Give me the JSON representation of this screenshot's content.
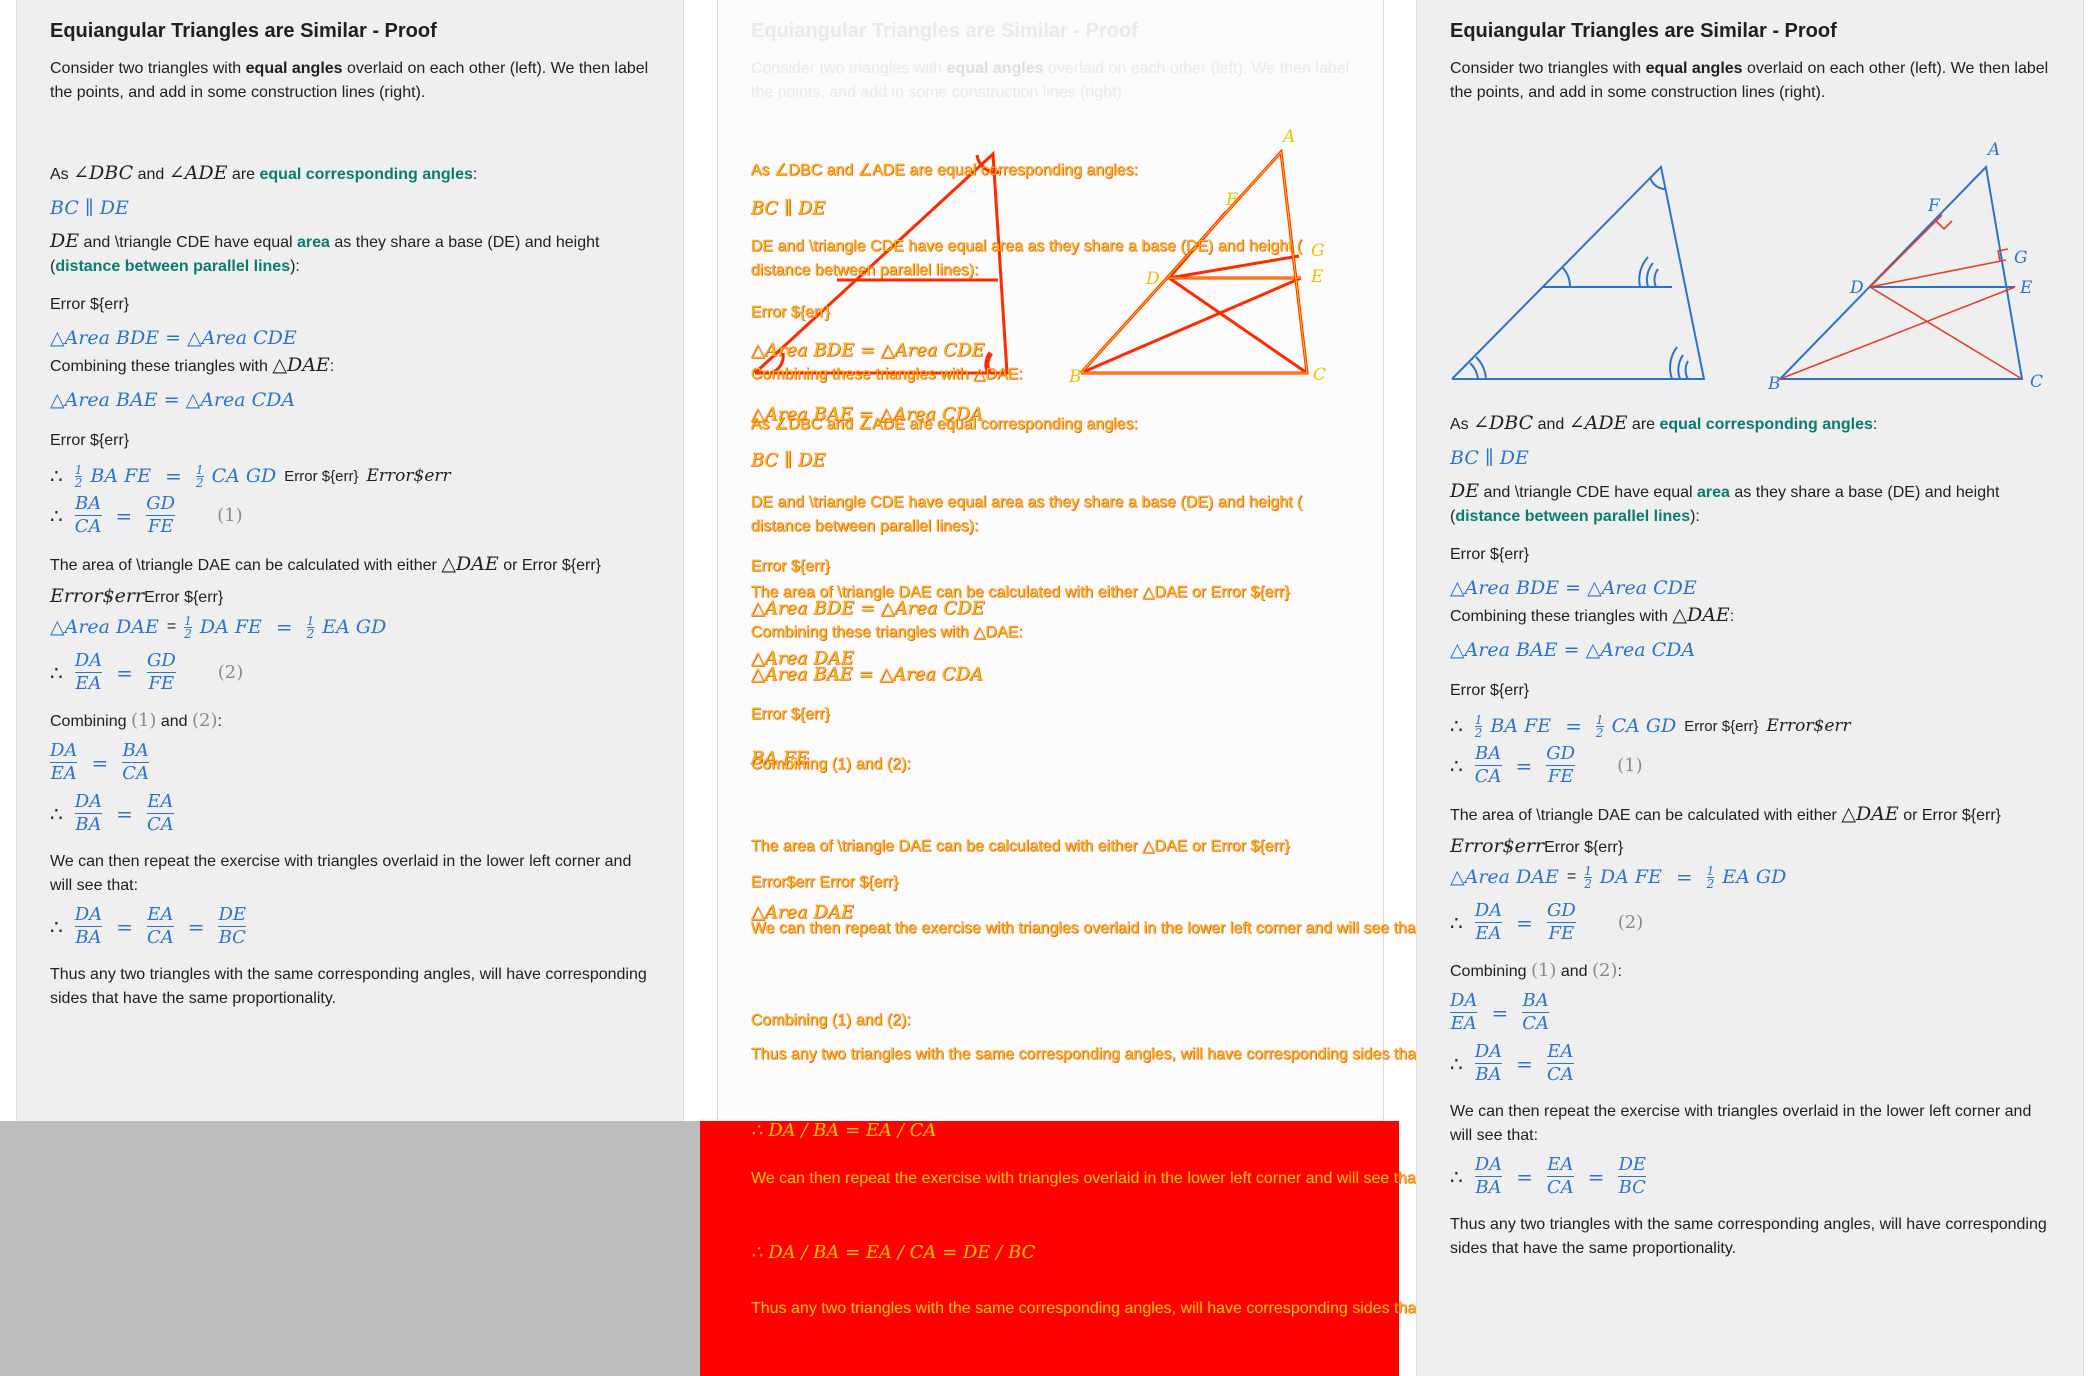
{
  "panels": {
    "title": "Equiangular Triangles are Similar - Proof",
    "intro_pre": "Consider two triangles with ",
    "intro_bold": "equal angles",
    "intro_post": " overlaid on each other (left). We then label the points, and add in some construction lines (right)."
  },
  "proof": {
    "s1_pre": "As ",
    "s1_m1": "∠DBC",
    "s1_mid": " and ",
    "s1_m2": "∠ADE",
    "s1_post": " are ",
    "s1_link": "equal corresponding angles",
    "s1_end": ":",
    "parallel": "BC ∥ DE",
    "s2_m": "DE",
    "s2_pre": " and \\triangle CDE have equal ",
    "s2_link1": "area",
    "s2_mid": " as they share a base (DE) and height (",
    "s2_link2": "distance between parallel lines",
    "s2_end": "):",
    "error": "Error ${err}",
    "area_eq1": "△Area BDE = △Area CDE",
    "combine_pre": "Combining these triangles with ",
    "combine_m": "△DAE",
    "combine_end": ":",
    "area_eq2": "△Area BAE = △Area CDA",
    "half_line_a": "BA FE",
    "half_line_b": "CA GD",
    "half_err_text": "Error ${err}",
    "half_err_math": "Error$err",
    "frac1_num": "BA",
    "frac1_den": "CA",
    "frac1_num2": "GD",
    "frac1_den2": "FE",
    "eq1_label": "(1)",
    "s3_pre": "The area of \\triangle DAE can be calculated with either ",
    "s3_m": "△DAE",
    "s3_post": " or Error ${err}",
    "err_math": "Error$err",
    "area_eq3_a": "△Area DAE",
    "area_eq3_b": "DA FE",
    "area_eq3_c": "EA GD",
    "frac2_num": "DA",
    "frac2_den": "EA",
    "frac2_num2": "GD",
    "frac2_den2": "FE",
    "eq2_label": "(2)",
    "combining_pre": "Combining ",
    "combining_1": "(1)",
    "combining_and": " and ",
    "combining_2": "(2)",
    "combining_end": ":",
    "f3_num": "DA",
    "f3_den": "EA",
    "f3_num2": "BA",
    "f3_den2": "CA",
    "f4_num": "DA",
    "f4_den": "BA",
    "f4_num2": "EA",
    "f4_den2": "CA",
    "repeat_text": "We can then repeat the exercise with triangles overlaid in the lower left corner and will see that:",
    "f5_num": "DA",
    "f5_den": "BA",
    "f5_num2": "EA",
    "f5_den2": "CA",
    "f5_num3": "DE",
    "f5_den3": "BC",
    "conclusion": "Thus any two triangles with the same corresponding angles, will have corresponding sides that have the same proportionality."
  },
  "diagram_labels": {
    "A": "A",
    "B": "B",
    "C": "C",
    "D": "D",
    "E": "E",
    "F": "F",
    "G": "G"
  },
  "overlay": {
    "error_line": "Error ${err}",
    "s3_line": "The area of \\triangle DAE can be calculated with either △DAE or Error ${err}",
    "err_line": "Error$err Error ${err}"
  },
  "colors": {
    "math_blue": "#2b74c9",
    "link_teal": "#0b7b72",
    "construction_red": "#e53c2b",
    "overlay_yellow": "#f0c000",
    "overlay_red": "#ff0000"
  }
}
